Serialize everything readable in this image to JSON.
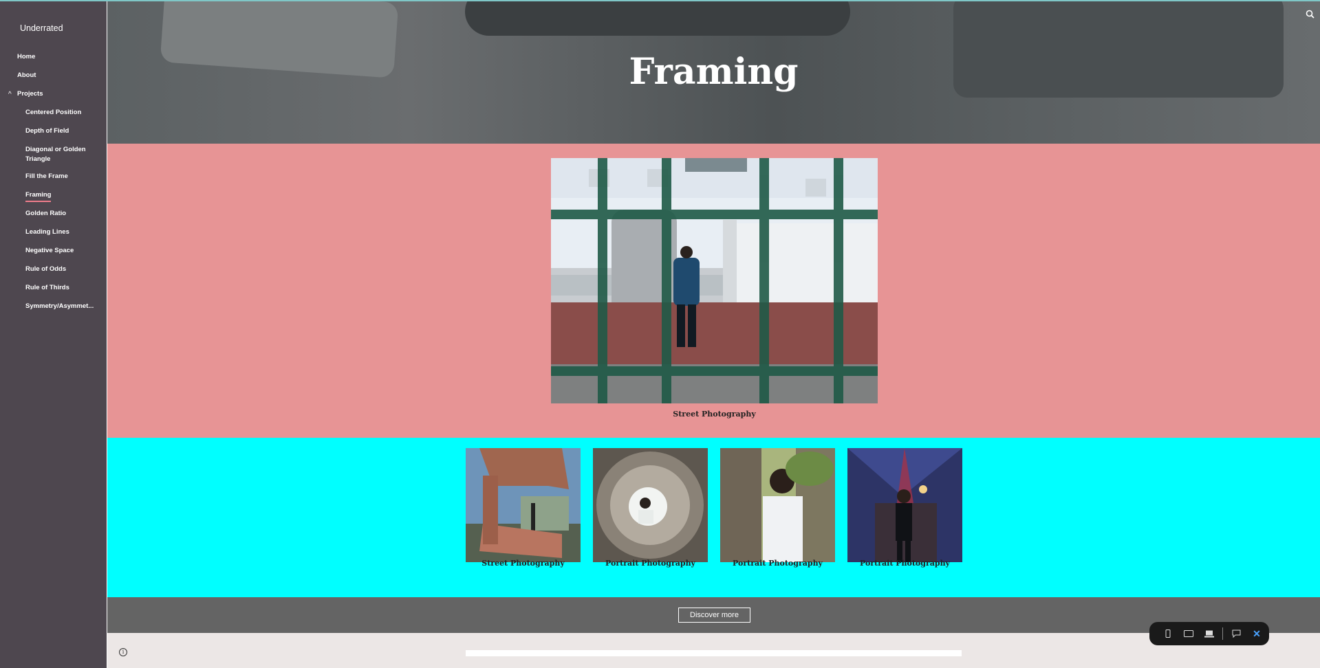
{
  "site": {
    "title": "Underrated"
  },
  "nav": {
    "home": "Home",
    "about": "About",
    "projects": "Projects",
    "projects_expanded_icon": "chevron-up-icon",
    "items": [
      "Centered Position",
      "Depth of Field",
      "Diagonal or Golden Triangle",
      "Fill the Frame",
      "Framing",
      "Golden Ratio",
      "Leading Lines",
      "Negative Space",
      "Rule of Odds",
      "Rule of Thirds",
      "Symmetry/Asymmet..."
    ],
    "active_item": "Framing"
  },
  "hero": {
    "title": "Framing",
    "search_icon": "search-icon"
  },
  "featured": {
    "caption": "Street Photography"
  },
  "gallery": {
    "captions": [
      "Street Photography",
      "Portrait Photography",
      "Portrait Photography",
      "Portrait Photography"
    ]
  },
  "discover": {
    "label": "Discover more"
  },
  "footer": {
    "info_icon": "info-icon",
    "info_glyph": "i"
  },
  "toolbar": {
    "icons": [
      "phone-view-icon",
      "tablet-view-icon",
      "laptop-view-icon",
      "feedback-icon",
      "close-icon"
    ],
    "close_glyph": "✕"
  },
  "colors": {
    "sidebar": "#4e474f",
    "pink_section": "#e79495",
    "cyan_section": "#00ffff",
    "grey_section": "#646464",
    "footer": "#ece7e6",
    "active_underline": "#f07d8c"
  }
}
